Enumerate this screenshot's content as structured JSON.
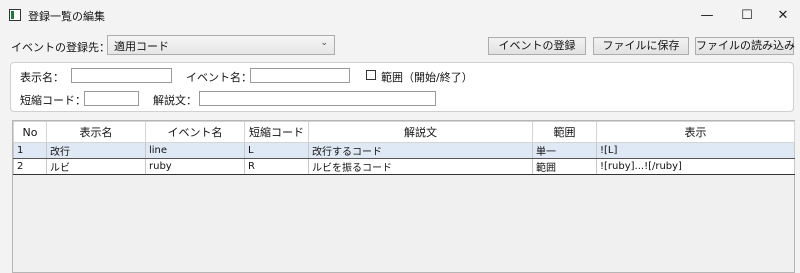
{
  "window": {
    "title": "登録一覧の編集",
    "minimize_icon": "—",
    "maximize_icon": "☐",
    "close_icon": "✕"
  },
  "event_selector": {
    "label": "イベントの登録先：",
    "value": "適用コード"
  },
  "toolbar": {
    "register_label": "イベントの登録",
    "save_label": "ファイルに保存",
    "load_label": "ファイルの読み込み"
  },
  "filters": {
    "display_name_label": "表示名：",
    "display_name_value": "",
    "event_name_label": "イベント名：",
    "event_name_value": "",
    "range_label": "範囲（開始/終了）",
    "range_checked": false,
    "short_code_label": "短縮コード：",
    "short_code_value": "",
    "description_label": "解説文：",
    "description_value": ""
  },
  "table": {
    "columns": [
      "No",
      "表示名",
      "イベント名",
      "短縮コード",
      "解説文",
      "範囲",
      "表示"
    ],
    "rows": [
      [
        "1",
        "改行",
        "line",
        "L",
        "改行するコード",
        "単一",
        "![L]"
      ],
      [
        "2",
        "ルビ",
        "ruby",
        "R",
        "ルビを振るコード",
        "範囲",
        "![ruby]...![/ruby]"
      ]
    ]
  }
}
